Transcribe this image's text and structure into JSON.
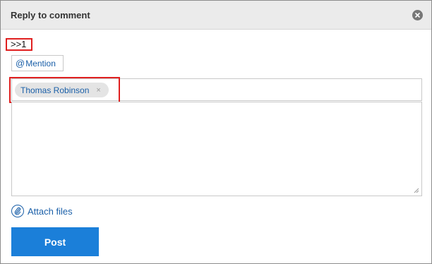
{
  "dialog": {
    "title": "Reply to comment",
    "close_icon": "close-icon"
  },
  "reply_reference": ">>1",
  "mention": {
    "at_symbol": "@",
    "label": "Mention"
  },
  "recipients": [
    {
      "name": "Thomas Robinson",
      "remove_symbol": "×"
    }
  ],
  "message": {
    "value": ""
  },
  "attach": {
    "label": "Attach files",
    "icon": "paperclip-icon"
  },
  "post_button": {
    "label": "Post"
  },
  "colors": {
    "header_bg": "#ebebeb",
    "highlight": "#e02020",
    "link": "#1a5fa8",
    "primary_button": "#1b7fd9"
  }
}
